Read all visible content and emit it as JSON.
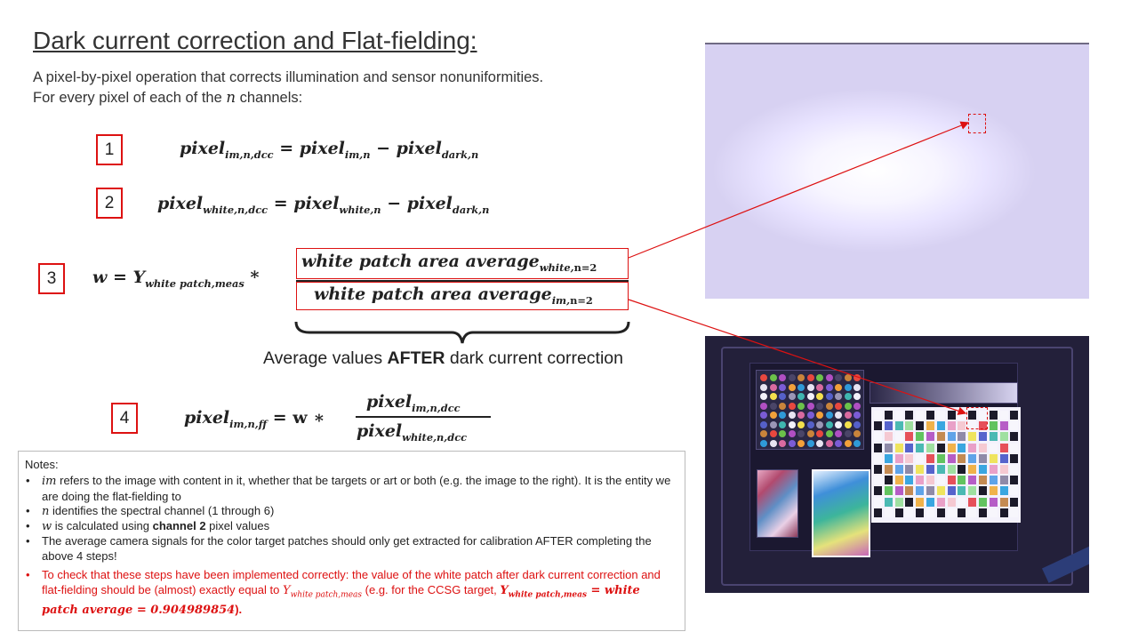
{
  "title": "Dark current correction and Flat-fielding:",
  "intro": {
    "line1": "A pixel-by-pixel operation that corrects illumination and sensor nonuniformities.",
    "line2_pre": "For every pixel of each of the ",
    "line2_var": "n",
    "line2_post": " channels:"
  },
  "steps": [
    {
      "label": "1"
    },
    {
      "label": "2"
    },
    {
      "label": "3"
    },
    {
      "label": "4"
    }
  ],
  "equations": {
    "eq1": {
      "lhs": "pixel",
      "lhs_sub": "im,n,dcc",
      "op": " = ",
      "t1": "pixel",
      "t1_sub": "im,n",
      "minus": " − ",
      "t2": "pixel",
      "t2_sub": "dark,n"
    },
    "eq2": {
      "lhs": "pixel",
      "lhs_sub": "white,n,dcc",
      "op": " = ",
      "t1": "pixel",
      "t1_sub": "white,n",
      "minus": " − ",
      "t2": "pixel",
      "t2_sub": "dark,n"
    },
    "eq3": {
      "lhs": "w = Y",
      "lhs_sub": "white patch,meas",
      "times": " *",
      "num": "white patch area average",
      "num_sub": "white,",
      "num_sub2": "n=2",
      "den": "white patch area average",
      "den_sub": "im,",
      "den_sub2": "n=2"
    },
    "eq4": {
      "lhs": "pixel",
      "lhs_sub": "im,n,ff",
      "op": " = w ∗ ",
      "num": "pixel",
      "num_sub": "im,n,dcc",
      "den": "pixel",
      "den_sub": "white,n,dcc"
    }
  },
  "annotation": {
    "pre": "Average values ",
    "bold": "AFTER",
    "post": " dark current correction"
  },
  "notes": {
    "title": "Notes:",
    "bullet": "•",
    "n1_var": "im",
    "n1_text": " refers to the image with content in it, whether that be targets or art or both (e.g. the image to the right). It is the entity we are doing the flat-fielding to",
    "n2_var": "n",
    "n2_text": " identifies the spectral channel (1 through 6)",
    "n3_var": "w",
    "n3_pre": " is calculated using ",
    "n3_bold": "channel 2",
    "n3_post": " pixel values",
    "n4": "The average camera signals for the color target patches should only get extracted for calibration AFTER completing the above 4 steps!",
    "n5_pre": "To check that these steps have been implemented correctly: the value of the white patch after dark current correction and flat-fielding should be (almost) exactly equal to ",
    "n5_var": "Y",
    "n5_var_sub": "white patch,meas",
    "n5_mid": " (e.g. for the CCSG target, ",
    "n5_eq_lhs": "Y",
    "n5_eq_lhs_sub": "white patch,meas",
    "n5_eq_rhs": " = white patch average = 0.904989854",
    "n5_end": ")."
  },
  "colors": {
    "accent_red": "#dd1111",
    "photo_top_bg": "#d7d1f2",
    "photo_bottom_bg": "#23203a"
  }
}
